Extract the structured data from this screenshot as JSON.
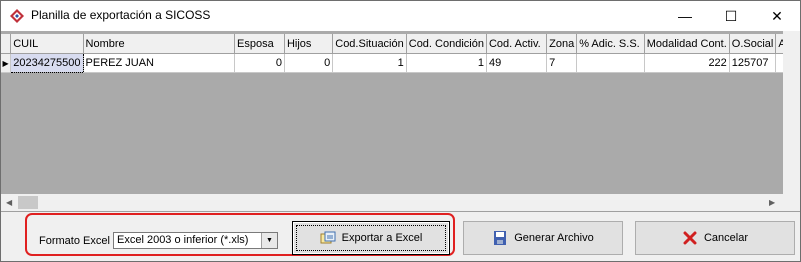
{
  "window": {
    "title": "Planilla de exportación a SICOSS",
    "minimize": "—",
    "maximize": "☐",
    "close": "✕"
  },
  "grid": {
    "columns": [
      "CUIL",
      "Nombre",
      "Esposa",
      "Hijos",
      "Cod.Situación",
      "Cod. Condición",
      "Cod. Activ.",
      "Zona",
      "% Adic. S.S.",
      "Modalidad Cont.",
      "O.Social",
      "Ac"
    ],
    "rows": [
      {
        "indicator": "▶",
        "cells": [
          "20234275500",
          "PEREZ  JUAN",
          "0",
          "0",
          "1",
          "1",
          "49",
          "7",
          "",
          "222",
          "125707",
          ""
        ]
      }
    ]
  },
  "footer": {
    "format_label": "Formato Excel",
    "format_value": "Excel 2003 o inferior (*.xls)",
    "export_button": "Exportar a Excel",
    "generate_button": "Generar Archivo",
    "cancel_button": "Cancelar"
  },
  "icons": {
    "app": "app-icon",
    "export": "excel-export-icon",
    "generate": "floppy-disk-icon",
    "cancel": "red-x-icon"
  },
  "colors": {
    "highlight": "#e02020",
    "selected_cell": "#d8dcf0"
  }
}
